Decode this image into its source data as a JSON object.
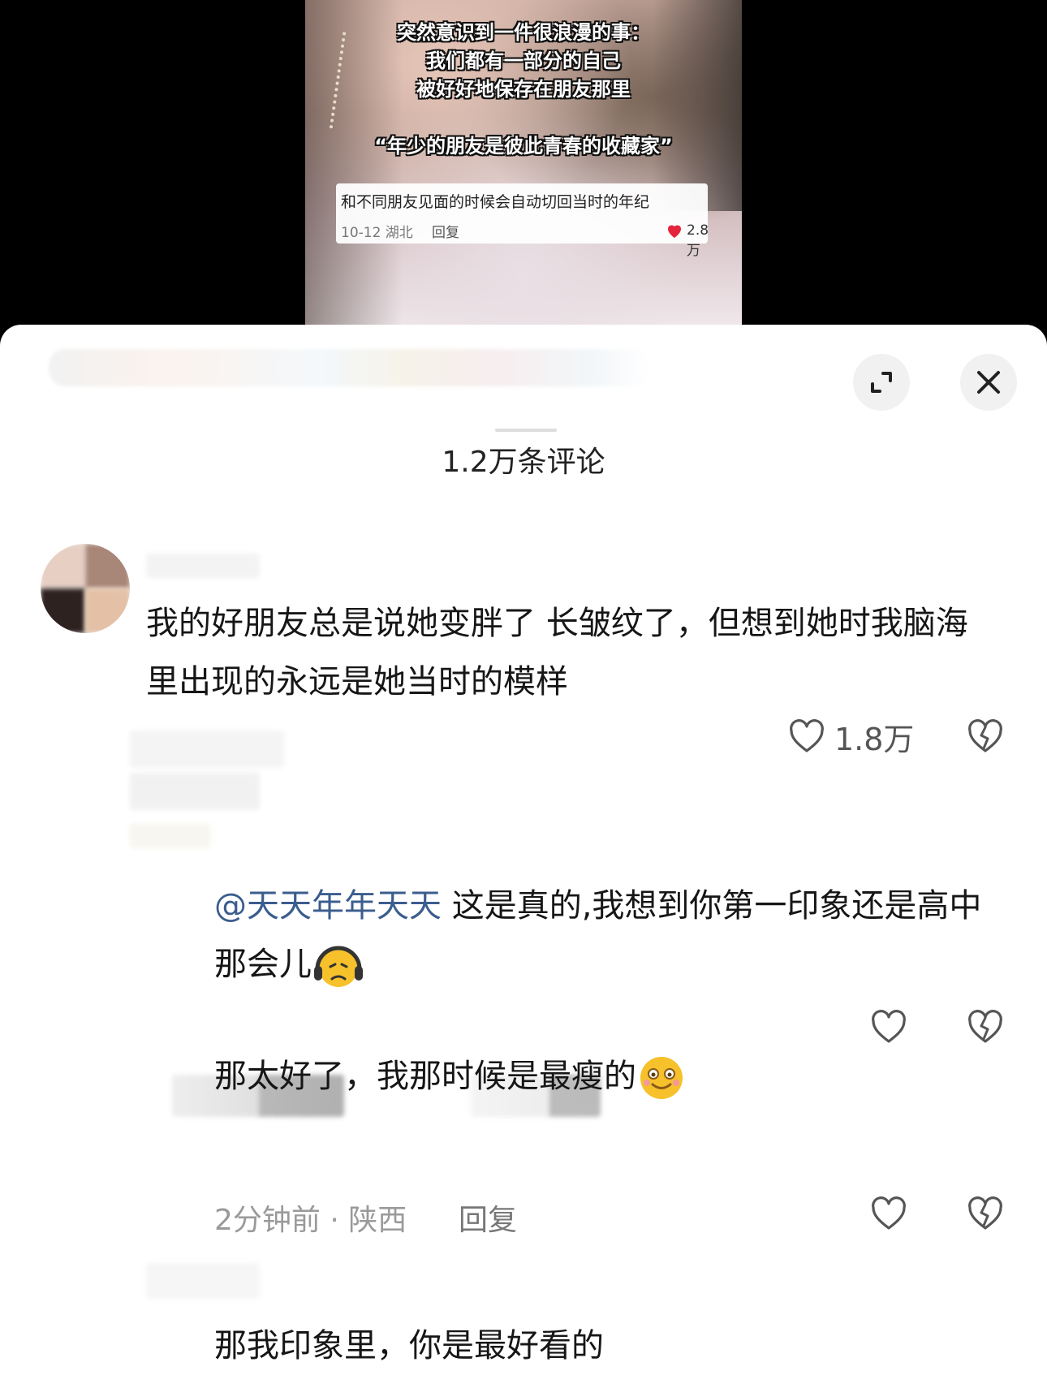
{
  "video": {
    "caption_lines": [
      "突然意识到一件很浪漫的事：",
      "我们都有一部分的自己",
      "被好好地保存在朋友那里",
      "“年少的朋友是彼此青春的收藏家”"
    ],
    "mini_comment": {
      "text": "和不同朋友见面的时候会自动切回当时的年纪",
      "meta": "10-12 湖北",
      "reply": "回复",
      "likes": "2.8万"
    }
  },
  "sheet": {
    "title": "1.2万条评论",
    "comments": [
      {
        "text": "我的好朋友总是说她变胖了 长皱纹了，但想到她时我脑海里出现的永远是她当时的模样",
        "likes": "1.8万"
      }
    ],
    "replies": [
      {
        "mention": "@天天年年天天",
        "text": " 这是真的,我想到你第一印象还是高中那会儿"
      },
      {
        "text": "那太好了，我那时候是最瘦的",
        "meta": "2分钟前 · 陕西",
        "reply_label": "回复"
      },
      {
        "text": "那我印象里，你是最好看的"
      }
    ]
  },
  "colors": {
    "mention": "#3b5d8e",
    "sheet_bg": "#ffffff",
    "heart_red": "#e5243b"
  },
  "icons": [
    "expand-icon",
    "close-icon",
    "heart-icon",
    "broken-heart-icon",
    "emoji-sad-icon",
    "emoji-smile-icon"
  ]
}
